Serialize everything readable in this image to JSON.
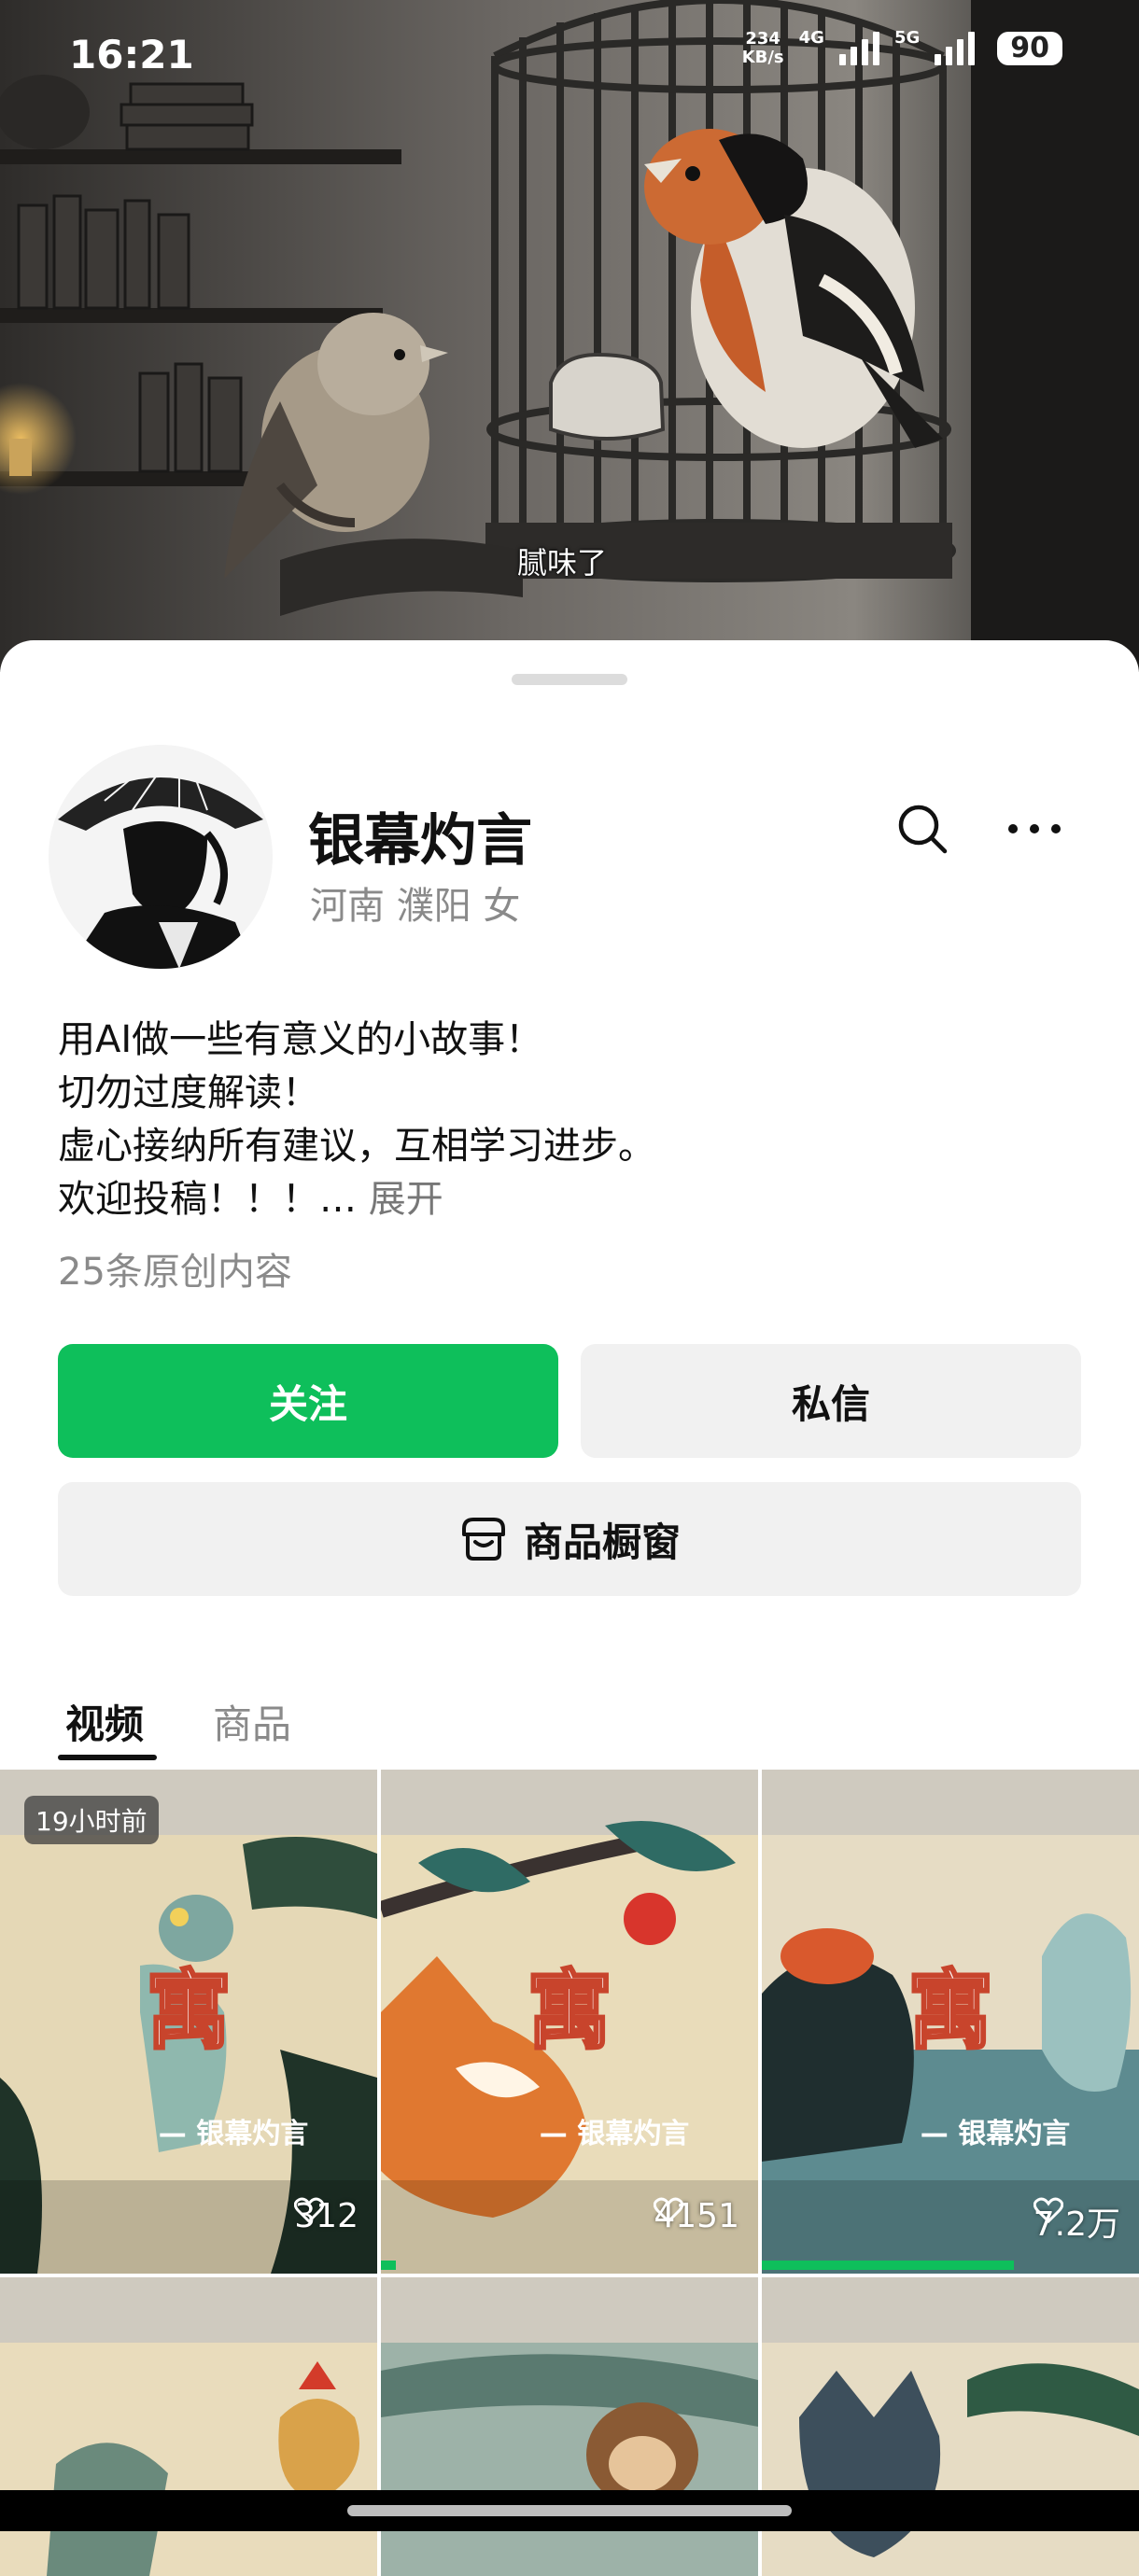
{
  "status_bar": {
    "time": "16:21",
    "net_speed_value": "234",
    "net_speed_unit": "KB/s",
    "network_1": "4G",
    "network_2": "5G",
    "battery": "90"
  },
  "video": {
    "caption": "腻味了"
  },
  "profile": {
    "name": "银幕灼言",
    "location": "河南 濮阳 女",
    "bio_lines": [
      "用AI做一些有意义的小故事！",
      "切勿过度解读！",
      "虚心接纳所有建议，互相学习进步。",
      "欢迎投稿！！！…"
    ],
    "bio_expand": "展开",
    "original_count": "25条原创内容"
  },
  "buttons": {
    "follow": "关注",
    "message": "私信",
    "shop_window": "商品橱窗"
  },
  "tabs": [
    {
      "label": "视频",
      "active": true
    },
    {
      "label": "商品",
      "active": false
    }
  ],
  "videos": [
    {
      "badge": "19小时前",
      "title_char": "寓",
      "watermark": "— 银幕灼言",
      "likes": "312",
      "progress": 0
    },
    {
      "badge": "",
      "title_char": "寓",
      "watermark": "— 银幕灼言",
      "likes": "4151",
      "progress": 0.04
    },
    {
      "badge": "",
      "title_char": "寓",
      "watermark": "— 银幕灼言",
      "likes": "7.2万",
      "progress": 0.67
    }
  ],
  "colors": {
    "accent_green": "#0ebf5b",
    "button_gray": "#f1f1f1"
  },
  "icons": {
    "search": "search-icon",
    "more": "more-icon",
    "shop": "shop-icon",
    "like": "heart-icon"
  }
}
